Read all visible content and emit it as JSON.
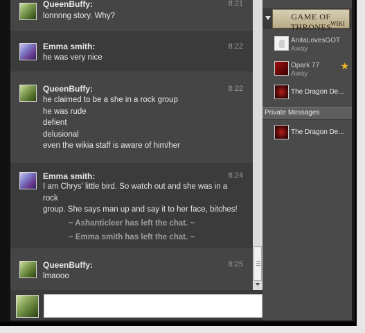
{
  "messages": [
    {
      "user": "QueenBuffy:",
      "time": "8:21",
      "lines": [
        "lonnnng story. Why?"
      ]
    },
    {
      "user": "Emma smith:",
      "time": "8:22",
      "lines": [
        "he was very nice"
      ]
    },
    {
      "user": "QueenBuffy:",
      "time": "8:22",
      "lines": [
        "he claimed to be a she in a rock group",
        "he was rude",
        "defient",
        "delusional",
        "even the wikia staff is aware of him/her"
      ]
    },
    {
      "user": "Emma smith:",
      "time": "8:24",
      "lines": [
        "I am Chrys' little bird. So watch out and she was in a rock",
        "group. She says man up and say it to her face, bitches!"
      ]
    },
    {
      "user": "QueenBuffy:",
      "time": "8:25",
      "lines": [
        "lmaooo"
      ]
    }
  ],
  "system_messages": [
    "~ Ashanticleer has left the chat. ~",
    "~ Emma smith has left the chat. ~"
  ],
  "sidebar": {
    "logo_main": "GAME OF THRONES",
    "logo_sub": "WIKI",
    "users": [
      {
        "name": "AnitaLovesGOT",
        "status": "Away"
      },
      {
        "name": "Opark 77",
        "status": "Away"
      },
      {
        "name": "The Dragon De...",
        "status": ""
      }
    ],
    "private_header": "Private Messages",
    "private_users": [
      {
        "name": "The Dragon De..."
      }
    ]
  },
  "icons": {
    "star": "star-icon",
    "collapse": "chevron-down-icon"
  },
  "colors": {
    "chat_bg": "#3b3b3b",
    "chat_alt_bg": "#454545",
    "sidebar_bg": "#4a4a4a",
    "star": "#f2b62c"
  }
}
